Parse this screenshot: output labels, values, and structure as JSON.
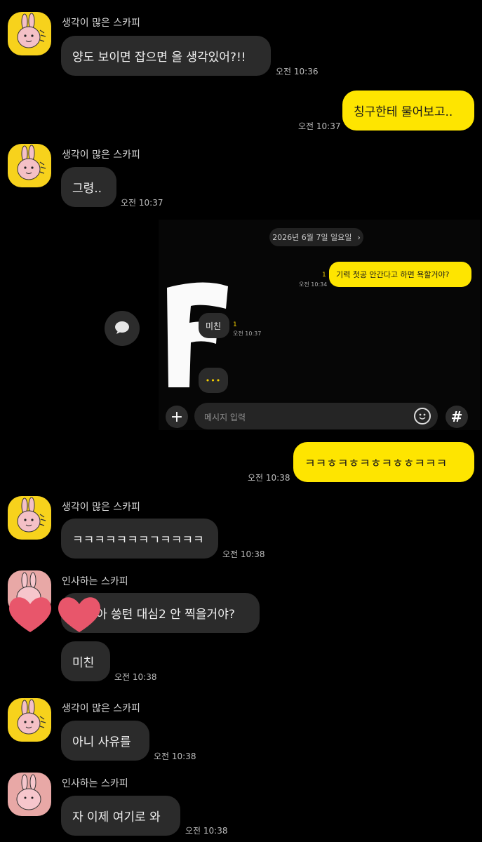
{
  "messages": [
    {
      "sender": "생각이 많은 스카피",
      "text": "양도 보이면 잡으면 올 생각있어?!!",
      "time": "오전 10:36"
    },
    {
      "mine": true,
      "text": "칭구한테 물어보고..",
      "time": "오전 10:37"
    },
    {
      "sender": "생각이 많은 스카피",
      "text": "그령..",
      "time": "오전 10:37"
    },
    {
      "mine": true,
      "text": "ㅋㅋㅎㅋㅎㅋㅎㅋㅎㅎㅋㅋㅋ",
      "time": "오전 10:38"
    },
    {
      "sender": "생각이 많은 스카피",
      "text": "ㅋㅋㅋㅋㅋㅋㅋㄱㅋㅋㅋㅋ",
      "time": "오전 10:38"
    },
    {
      "sender": "인사하는 스카피",
      "text": "아 씅텬 대심2 안 찍을거야?"
    },
    {
      "text": "미친",
      "time": "오전 10:38"
    },
    {
      "sender": "생각이 많은 스카피",
      "text": "아니 사유를",
      "time": "오전 10:38"
    },
    {
      "sender": "인사하는 스카피",
      "text": "자 이제 여기로 와",
      "time": "오전 10:38"
    }
  ],
  "embedded": {
    "date_label": "2026년 6월 7일 일요일",
    "chevron_icon": "chevron-right-icon",
    "mine_text": "기력 첫공 안간다고 하면 욕할거야?",
    "mine_unread": "1",
    "mine_time": "오전 10:34",
    "reply_text": "미친",
    "reply_unread": "1",
    "reply_time": "오전 10:37",
    "typing_indicator": "•••",
    "censor_letter": "F",
    "input_placeholder": "메시지 입력",
    "plus_icon": "plus-icon",
    "emoji_icon": "emoji-icon",
    "hash_icon": "hashtag-icon",
    "chat_icon": "chat-bubble-icon"
  },
  "colors": {
    "background": "#000000",
    "my_bubble": "#fee500",
    "other_bubble": "#2b2b2b",
    "heart": "#e8566b"
  }
}
